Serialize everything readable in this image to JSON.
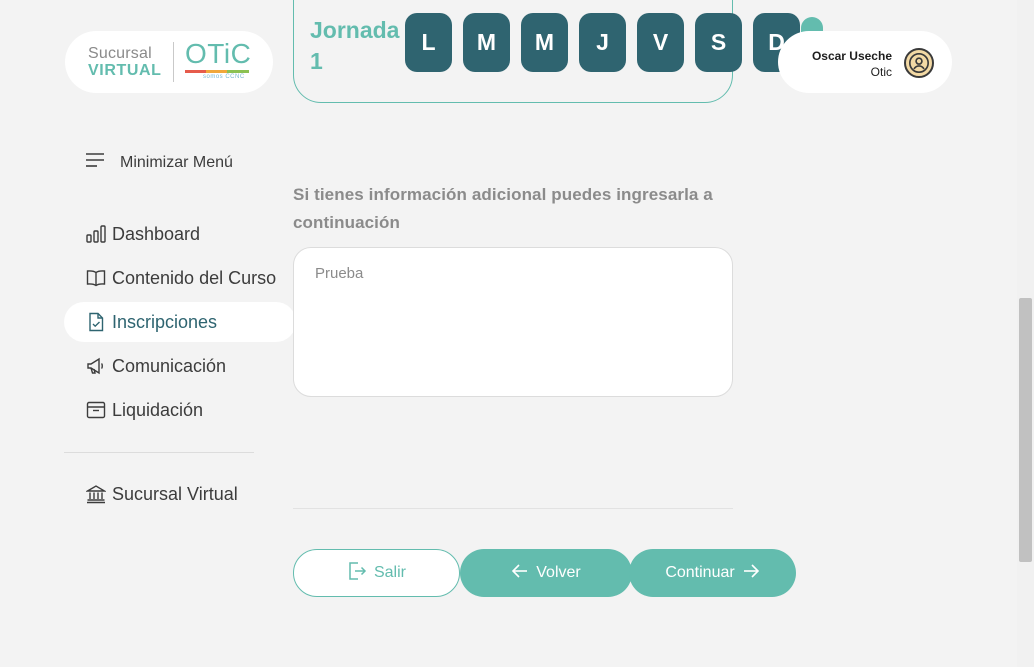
{
  "logo": {
    "line1": "Sucursal",
    "line2": "VIRTUAL",
    "brand": "OTiC",
    "brand_sub": "somos CCNC"
  },
  "user": {
    "name": "Oscar Useche",
    "org": "Otic"
  },
  "sidebar": {
    "toggle_label": "Minimizar Menú",
    "items": [
      {
        "label": "Dashboard",
        "icon": "bar-chart-icon"
      },
      {
        "label": "Contenido del Curso",
        "icon": "open-book-icon"
      },
      {
        "label": "Inscripciones",
        "icon": "file-check-icon",
        "active": true
      },
      {
        "label": "Comunicación",
        "icon": "megaphone-icon"
      },
      {
        "label": "Liquidación",
        "icon": "archive-box-icon"
      }
    ],
    "bottom_item": {
      "label": "Sucursal Virtual",
      "icon": "bank-icon"
    }
  },
  "jornada": {
    "title": "Jornada 1",
    "days": [
      "L",
      "M",
      "M",
      "J",
      "V",
      "S",
      "D"
    ]
  },
  "form": {
    "hint": "Si tienes información adicional puedes ingresarla a continuación",
    "textarea_value": "Prueba"
  },
  "buttons": {
    "exit": "Salir",
    "back": "Volver",
    "continue": "Continuar"
  },
  "colors": {
    "accent": "#63bcae",
    "day_button": "#2f6470",
    "active_nav_text": "#2e6470",
    "background": "#f3f3f3"
  }
}
